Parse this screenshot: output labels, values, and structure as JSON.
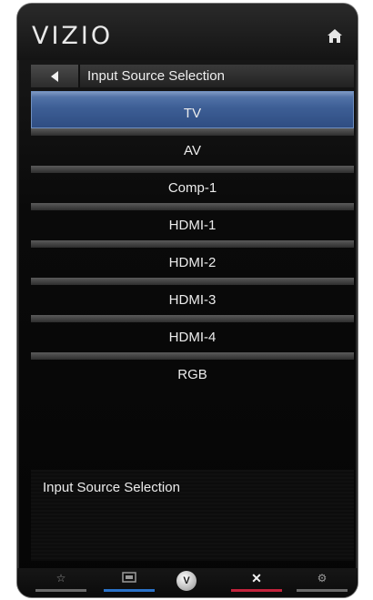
{
  "brand": {
    "logo_text": "VIZIO"
  },
  "header": {
    "title": "Input Source Selection"
  },
  "menu": {
    "items": [
      {
        "label": "TV",
        "selected": true
      },
      {
        "label": "AV"
      },
      {
        "label": "Comp-1"
      },
      {
        "label": "HDMI-1"
      },
      {
        "label": "HDMI-2"
      },
      {
        "label": "HDMI-3"
      },
      {
        "label": "HDMI-4"
      },
      {
        "label": "RGB"
      }
    ]
  },
  "description": {
    "text": "Input Source Selection"
  },
  "bottom_nav": {
    "items": [
      {
        "icon": "star-icon",
        "accent": "#6a6a6a"
      },
      {
        "icon": "input-icon",
        "accent": "#2a72c9"
      },
      {
        "icon": "vizio-v-icon",
        "label": "V"
      },
      {
        "icon": "close-icon",
        "accent": "#c2223c",
        "label": "✕"
      },
      {
        "icon": "settings-icon",
        "accent": "#6a6a6a"
      }
    ]
  },
  "colors": {
    "selection": "#3d5e95",
    "blue_accent": "#2a72c9",
    "red_accent": "#c2223c"
  }
}
